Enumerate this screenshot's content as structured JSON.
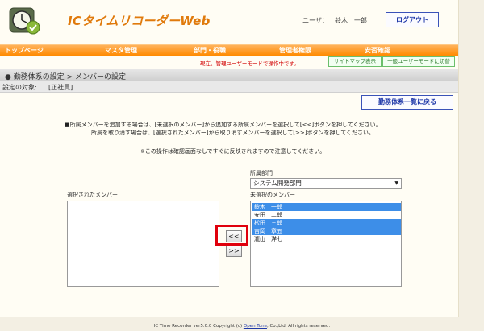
{
  "header": {
    "app_title": "ICタイムリコーダーWeb",
    "user_label": "ユーザ：",
    "user_name": "鈴木　一郎",
    "logout_label": "ログアウト"
  },
  "menu": {
    "items": [
      "トップページ",
      "マスタ管理",
      "部門・役職",
      "管理者権限",
      "安否確認"
    ]
  },
  "mode_message": "現在、管理ユーザーモードで操作中です。",
  "sub_buttons": {
    "sitemap_label": "サイトマップ表示",
    "general_mode_label": "一般ユーザーモードに切替"
  },
  "section": {
    "title": "● 勤務体系の設定 > メンバーの設定",
    "target_label": "設定の対象:",
    "target_value": "[正社員]"
  },
  "back_button_label": "勤務体系一覧に戻る",
  "instructions": {
    "line1": "■所属メンバーを追加する場合は、[未選択のメンバー]から追加する所属メンバーを選択して[<<]ボタンを押してください。",
    "line2": "所属を取り消す場合は、[選択されたメンバー]から取り消すメンバーを選択して[>>]ボタンを押してください。",
    "note": "※この操作は確認画面なしですぐに反映されますので注意してください。"
  },
  "department": {
    "label": "所属部門",
    "selected": "システム開発部門"
  },
  "selected_members": {
    "label": "選択されたメンバー",
    "items": []
  },
  "unselected_members": {
    "label": "未選択のメンバー",
    "items": [
      {
        "name": "鈴木　一郎",
        "selected": true
      },
      {
        "name": "安田　二郎",
        "selected": false
      },
      {
        "name": "松田　三郎",
        "selected": true
      },
      {
        "name": "吉岡　章五",
        "selected": true
      },
      {
        "name": "瀧山　洋七",
        "selected": false
      }
    ]
  },
  "buttons": {
    "add_label": "<<",
    "remove_label": ">>"
  },
  "footer": {
    "prefix": "IC Time Recorder ver5.0.0 Copyright (c) ",
    "link": "Open Tone",
    "suffix": ", Co.,Ltd. All rights reserved."
  },
  "colors": {
    "accent": "#ff8a00",
    "title": "#e07a0c",
    "selection": "#3d8ee8",
    "highlight": "#e0000c"
  }
}
